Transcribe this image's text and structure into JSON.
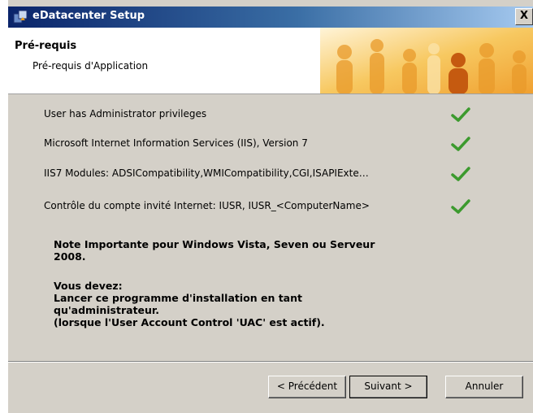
{
  "window": {
    "title": "eDatacenter Setup",
    "close_label": "X"
  },
  "header": {
    "title": "Pré-requis",
    "subtitle": "Pré-requis d'Application"
  },
  "requirements": [
    {
      "label": "User has Administrator privileges",
      "status": "ok"
    },
    {
      "label": "Microsoft Internet Information Services (IIS), Version 7",
      "status": "ok"
    },
    {
      "label": "IIS7 Modules: ADSICompatibility,WMICompatibility,CGI,ISAPIExte…",
      "status": "ok"
    },
    {
      "label": "Contrôle du compte invité Internet: IUSR, IUSR_<ComputerName>",
      "status": "ok"
    }
  ],
  "note": {
    "heading_line1": "Note Importante pour Windows Vista, Seven ou Serveur",
    "heading_line2": "2008.",
    "line1": "Vous devez:",
    "line2": "Lancer ce programme d'installation en tant",
    "line3": "qu'administrateur.",
    "line4": "(lorsque l'User Account Control 'UAC' est actif)."
  },
  "buttons": {
    "back": "< Précédent",
    "next": "Suivant >",
    "cancel": "Annuler"
  },
  "colors": {
    "titlebar_start": "#0a246a",
    "titlebar_end": "#a6caf0",
    "dialog_bg": "#d4d0c8",
    "check": "#3c9a2e",
    "banner": "#f5a623"
  },
  "icons": {
    "app": "setup-icon",
    "check": "checkmark-icon"
  }
}
